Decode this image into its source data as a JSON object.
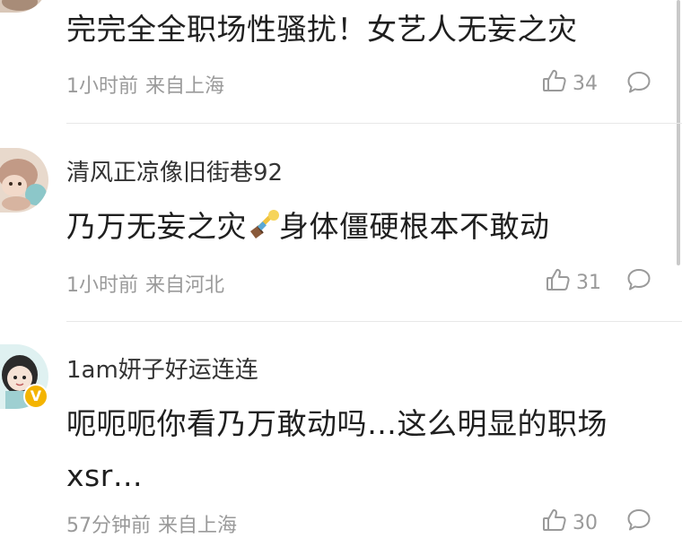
{
  "comments": [
    {
      "username": "",
      "text": "完完全全职场性骚扰！女艺人无妄之灾",
      "time": "1小时前",
      "location": "来自上海",
      "likes": "34"
    },
    {
      "username": "清风正凉像旧街巷92",
      "text_before": "乃万无妄之灾",
      "text_after": "身体僵硬根本不敢动",
      "emoji": "broom-emoji",
      "time": "1小时前",
      "location": "来自河北",
      "likes": "31"
    },
    {
      "username": "1am妍子好运连连",
      "text": "呃呃呃你看乃万敢动吗…这么明显的职场xsr…",
      "verified_badge": "V",
      "time": "57分钟前",
      "location": "来自上海",
      "likes": "30"
    }
  ],
  "icons": {
    "like": "thumbs-up-icon",
    "reply": "comment-bubble-icon"
  },
  "colors": {
    "meta_gray": "#9a9a9a",
    "badge_gold": "#f4b400"
  }
}
